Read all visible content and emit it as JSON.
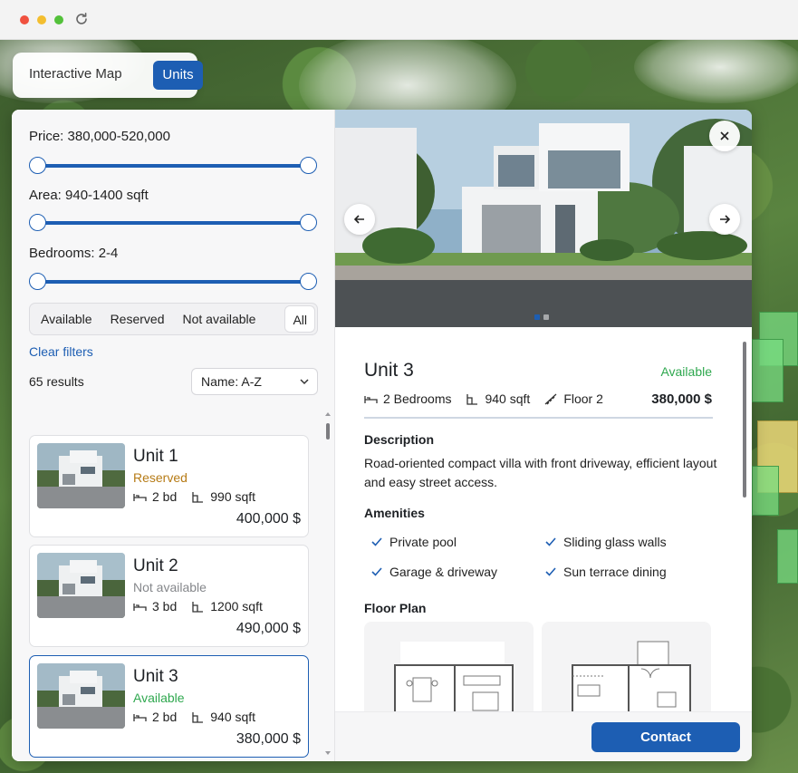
{
  "toggle": {
    "map_label": "Interactive Map",
    "units_label": "Units",
    "active": "Units"
  },
  "filters": {
    "price_label": "Price: 380,000-520,000",
    "area_label": "Area: 940-1400 sqft",
    "bedrooms_label": "Bedrooms: 2-4",
    "availability": [
      "Available",
      "Reserved",
      "Not available",
      "All"
    ],
    "availability_selected": "All",
    "clear_label": "Clear filters",
    "results_label": "65 results",
    "sort_label": "Name: A-Z"
  },
  "units": [
    {
      "title": "Unit 1",
      "status": "Reserved",
      "beds": "2 bd",
      "area": "990 sqft",
      "price": "400,000 $"
    },
    {
      "title": "Unit 2",
      "status": "Not available",
      "beds": "3 bd",
      "area": "1200 sqft",
      "price": "490,000 $"
    },
    {
      "title": "Unit 3",
      "status": "Available",
      "beds": "2 bd",
      "area": "940 sqft",
      "price": "380,000 $"
    }
  ],
  "detail": {
    "title": "Unit 3",
    "status": "Available",
    "bedrooms": "2 Bedrooms",
    "area": "940 sqft",
    "floor": "Floor 2",
    "price": "380,000 $",
    "description_heading": "Description",
    "description": "Road-oriented compact villa with front driveway, efficient layout and easy street access.",
    "amenities_heading": "Amenities",
    "amenities": [
      "Private pool",
      "Sliding glass walls",
      "Garage & driveway",
      "Sun terrace dining"
    ],
    "floorplan_heading": "Floor Plan",
    "contact_label": "Contact"
  },
  "icons": {
    "close": "close-icon",
    "prev": "arrow-left-icon",
    "next": "arrow-right-icon",
    "bed": "bed-icon",
    "area": "area-icon",
    "floor": "stairs-icon",
    "check": "check-icon",
    "chevron": "chevron-down-icon",
    "reload": "reload-icon"
  },
  "colors": {
    "accent": "#1d5eb3",
    "available": "#2fa84f",
    "reserved": "#b67b16",
    "not_available": "#85878b"
  }
}
